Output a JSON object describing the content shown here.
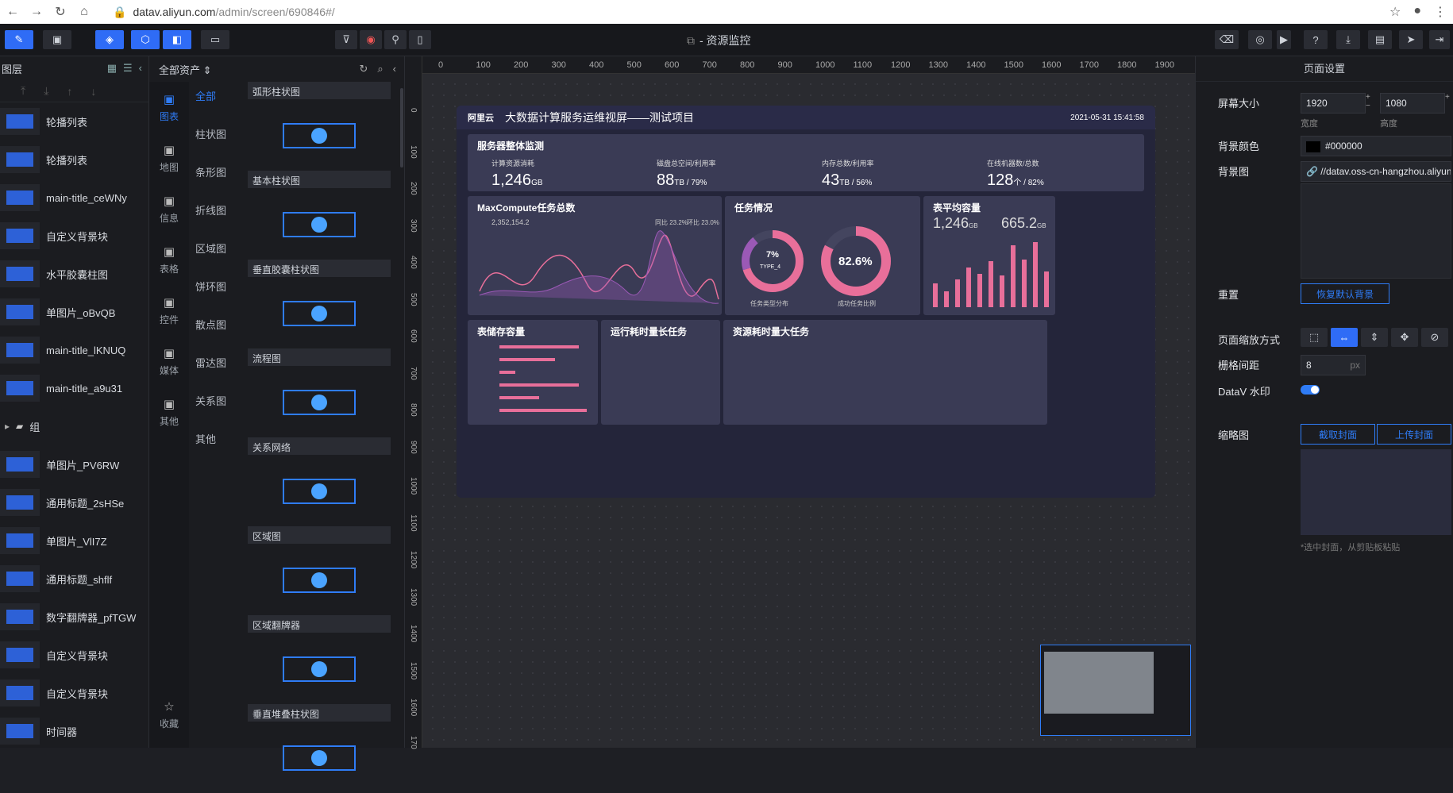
{
  "browser": {
    "url_host": "datav.aliyun.com",
    "url_path": "/admin/screen/690846#/"
  },
  "app": {
    "title": "- 资源监控"
  },
  "layers": {
    "header": "图层",
    "items": [
      {
        "label": "轮播列表"
      },
      {
        "label": "轮播列表"
      },
      {
        "label": "main-title_ceWNy"
      },
      {
        "label": "自定义背景块"
      },
      {
        "label": "水平胶囊柱图"
      },
      {
        "label": "单图片_oBvQB"
      },
      {
        "label": "main-title_lKNUQ"
      },
      {
        "label": "main-title_a9u31"
      },
      {
        "label": "组",
        "group": true
      },
      {
        "label": "单图片_PV6RW"
      },
      {
        "label": "通用标题_2sHSe"
      },
      {
        "label": "单图片_VlI7Z"
      },
      {
        "label": "通用标题_shflf"
      },
      {
        "label": "数字翻牌器_pfTGW"
      },
      {
        "label": "自定义背景块"
      },
      {
        "label": "自定义背景块"
      },
      {
        "label": "时间器"
      }
    ]
  },
  "components": {
    "header": "全部资产",
    "categories": [
      {
        "label": "图表",
        "icon": "bar-chart-icon"
      },
      {
        "label": "地图",
        "icon": "map-pin-icon"
      },
      {
        "label": "信息",
        "icon": "text-icon"
      },
      {
        "label": "表格",
        "icon": "table-icon"
      },
      {
        "label": "控件",
        "icon": "control-icon"
      },
      {
        "label": "媒体",
        "icon": "media-icon"
      },
      {
        "label": "其他",
        "icon": "other-icon"
      }
    ],
    "favorite": "收藏",
    "subcategories": [
      "全部",
      "柱状图",
      "条形图",
      "折线图",
      "区域图",
      "饼环图",
      "散点图",
      "雷达图",
      "关系图",
      "其他"
    ],
    "tiles": [
      "弧形柱状图",
      "基本柱状图",
      "垂直胶囊柱状图",
      "流程图",
      "关系网络",
      "区域图",
      "区域翻牌器",
      "垂直堆叠柱状图"
    ]
  },
  "ruler": {
    "h": [
      "0",
      "100",
      "200",
      "300",
      "400",
      "500",
      "600",
      "700",
      "800",
      "900",
      "1000",
      "1100",
      "1200",
      "1300",
      "1400",
      "1500",
      "1600",
      "1700",
      "1800",
      "1900"
    ],
    "v": [
      "0",
      "100",
      "200",
      "300",
      "400",
      "500",
      "600",
      "700",
      "800",
      "900",
      "1000",
      "1100",
      "1200",
      "1300",
      "1400",
      "1500",
      "1600",
      "170"
    ]
  },
  "screen": {
    "logo": "阿里云",
    "title": "大数据计算服务运维视屏——测试项目",
    "date": "2021-05-31 15:41:58",
    "panel_monitor": "服务器整体监测",
    "kpis": [
      {
        "label": "计算资源消耗",
        "value": "1,246",
        "unit": "GB"
      },
      {
        "label": "磁盘总空间/利用率",
        "value": "88",
        "unit": "TB / 79%"
      },
      {
        "label": "内存总数/利用率",
        "value": "43",
        "unit": "TB / 56%"
      },
      {
        "label": "在线机器数/总数",
        "value": "128",
        "unit": "个 / 82%"
      }
    ],
    "panel_tasks": "MaxCompute任务总数",
    "tasks_total": "2,352,154.2",
    "tasks_ratio1": "同比 23.2%",
    "tasks_ratio2": "环比 23.0%",
    "panel_status": "任务情况",
    "donut1_value": "7%",
    "donut1_label": "TYPE_4",
    "donut1_caption": "任务类型分布",
    "donut2_value": "82.6%",
    "donut2_caption": "成功任务比例",
    "panel_capacity": "表平均容量",
    "cap1": "1,246",
    "cap1_unit": "GB",
    "cap2": "665.2",
    "cap2_unit": "GB",
    "panel_storage": "表储存容量",
    "panel_runtime": "运行耗时量长任务",
    "panel_resource": "资源耗时量大任务"
  },
  "props": {
    "header": "页面设置",
    "screen_size_label": "屏幕大小",
    "width": "1920",
    "height": "1080",
    "width_label": "宽度",
    "height_label": "高度",
    "bg_color_label": "背景颜色",
    "bg_color": "#000000",
    "bg_image_label": "背景图",
    "bg_image": "//datav.oss-cn-hangzhou.aliyuncs",
    "reset_label": "重置",
    "reset_button": "恢复默认背景",
    "zoom_label": "页面缩放方式",
    "grid_label": "栅格间距",
    "grid_value": "8",
    "grid_unit": "px",
    "watermark_label": "DataV 水印",
    "thumb_label": "缩略图",
    "capture_button": "截取封面",
    "upload_button": "上传封面",
    "thumb_hint": "*选中封面，从剪贴板粘贴"
  },
  "colors": {
    "accent": "#2f7cf6",
    "pink": "#e86f9a",
    "purple": "#9b59b6"
  }
}
